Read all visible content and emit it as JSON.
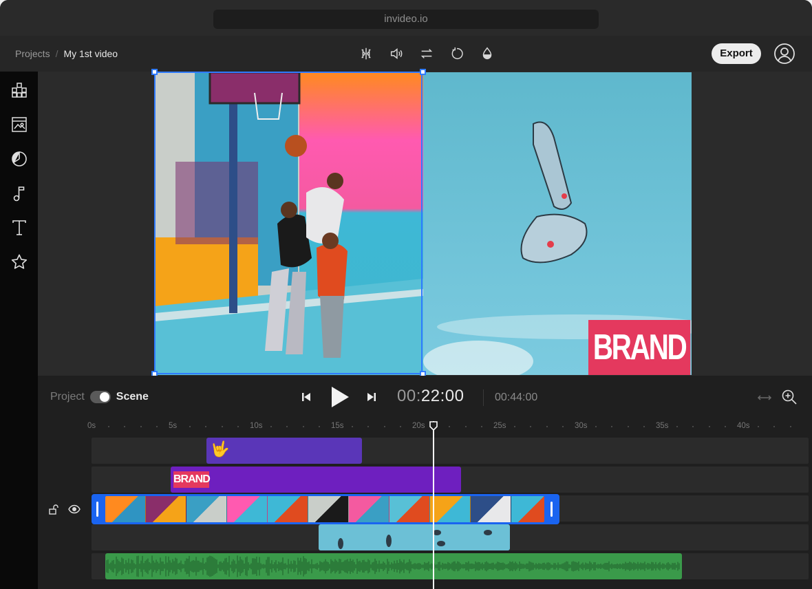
{
  "browser": {
    "url": "invideo.io"
  },
  "header": {
    "breadcrumb_root": "Projects",
    "breadcrumb_sep": "/",
    "project_name": "My 1st video",
    "export_label": "Export",
    "tools": [
      "split-icon",
      "volume-icon",
      "swap-icon",
      "rotate-icon",
      "opacity-icon"
    ]
  },
  "sidebar": {
    "items": [
      "templates-icon",
      "media-icon",
      "stickers-icon",
      "music-icon",
      "text-icon",
      "favorites-icon"
    ]
  },
  "canvas": {
    "brand_text": "BRAND"
  },
  "player": {
    "mode_left": "Project",
    "mode_right": "Scene",
    "time_dim": "00:",
    "time_bright": "22:00",
    "duration": "00:44:00"
  },
  "timeline": {
    "ruler": [
      "0s",
      "5s",
      "10s",
      "15s",
      "20s",
      "25s",
      "30s",
      "35s",
      "40s"
    ],
    "sticker_label": "🤟",
    "brand_clip_label": "BRAND",
    "playhead_time": "22s"
  },
  "colors": {
    "accent": "#2f7bff",
    "sticker_track": "#5a36b8",
    "brand_track": "#6e1fbf",
    "audio_track": "#3a9a4a",
    "brand_bg": "#e4395e"
  }
}
